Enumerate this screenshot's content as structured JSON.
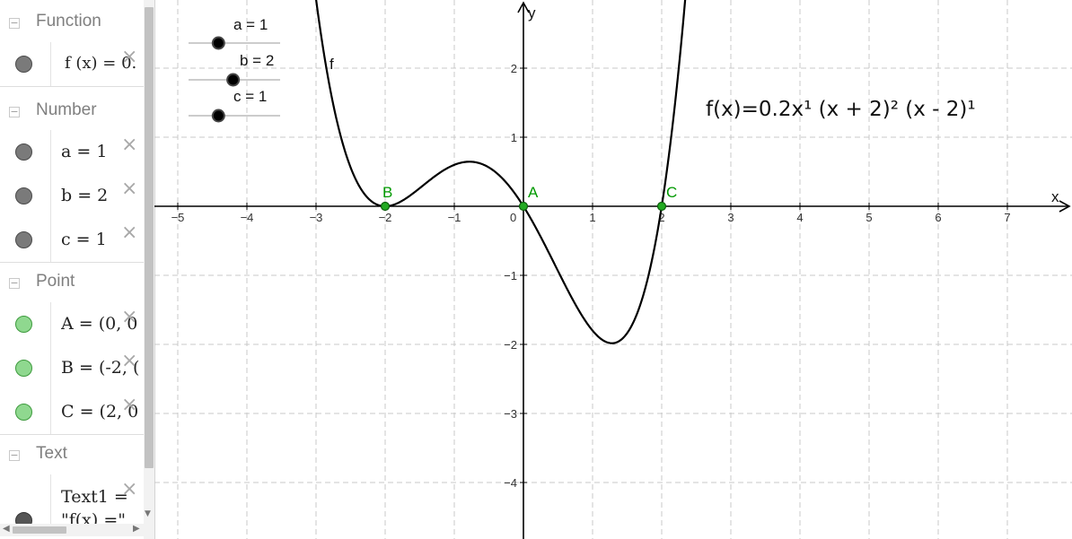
{
  "algebra": {
    "categories": {
      "function": "Function",
      "number": "Number",
      "point": "Point",
      "text": "Text"
    },
    "rows": {
      "f": {
        "text": "f (x)  =  0.",
        "color": "#7a7a7a"
      },
      "a": {
        "text": "a  =  1",
        "color": "#7a7a7a"
      },
      "b": {
        "text": "b  =  2",
        "color": "#7a7a7a"
      },
      "c": {
        "text": "c  =  1",
        "color": "#7a7a7a"
      },
      "A": {
        "text": "A  =  (0,  0",
        "color": "#8fd88f"
      },
      "B": {
        "text": "B  =  (-2,  (",
        "color": "#8fd88f"
      },
      "C": {
        "text": "C  =  (2,  0",
        "color": "#8fd88f"
      },
      "text1_line1": "Text1  =",
      "text1_line2": "\"f(x)  =\""
    },
    "delete_glyph": "×"
  },
  "graphics": {
    "sliders": [
      {
        "name": "a",
        "label": "a = 1",
        "value": 1,
        "min": 0,
        "max": 5
      },
      {
        "name": "b",
        "label": "b = 2",
        "value": 2,
        "min": 0,
        "max": 5
      },
      {
        "name": "c",
        "label": "c = 1",
        "value": 1,
        "min": 0,
        "max": 5
      }
    ],
    "function_label": "f",
    "equation_text": "f(x)=0.2x¹ (x + 2)² (x - 2)¹",
    "axis_labels": {
      "x": "x",
      "y": "y",
      "origin": "0"
    },
    "points": [
      {
        "name": "A",
        "x": 0,
        "y": 0
      },
      {
        "name": "B",
        "x": -2,
        "y": 0
      },
      {
        "name": "C",
        "x": 2,
        "y": 0
      }
    ],
    "colors": {
      "point_fill": "#22aa22",
      "point_label": "#009900",
      "curve": "#000000",
      "grid": "#c8c8c8"
    }
  },
  "chart_data": {
    "type": "line",
    "xlabel": "x",
    "ylabel": "y",
    "xlim": [
      -5.2,
      7.8
    ],
    "ylim": [
      -4.8,
      2.95
    ],
    "x_ticks": [
      -5,
      -4,
      -3,
      -2,
      -1,
      1,
      2,
      3,
      4,
      5,
      6,
      7
    ],
    "y_ticks": [
      -4,
      -3,
      -2,
      -1,
      1,
      2
    ],
    "grid": true,
    "series": [
      {
        "name": "f",
        "expression": "0.2*x*(x+2)^2*(x-2)",
        "coef": 0.2,
        "a": 1,
        "b": 2,
        "c": 1,
        "roots": [
          0,
          -2,
          2
        ]
      }
    ]
  }
}
